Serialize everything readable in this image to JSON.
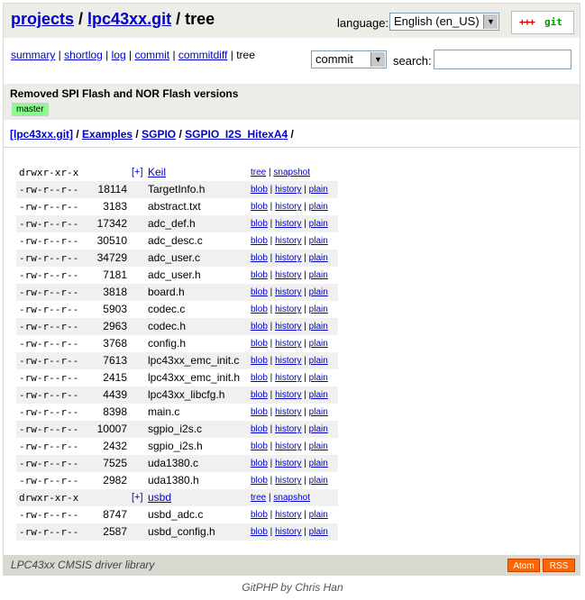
{
  "header": {
    "breadcrumb_projects": "projects",
    "breadcrumb_sep1": " / ",
    "breadcrumb_repo": "lpc43xx.git",
    "breadcrumb_sep2": " / tree",
    "language_label": "language:",
    "language_value": "English (en_US)",
    "logo_plus": "+++",
    "logo_text": "git"
  },
  "nav": {
    "links": [
      "summary",
      "shortlog",
      "log",
      "commit",
      "commitdiff"
    ],
    "current": "tree",
    "search_type": "commit",
    "search_label": "search:",
    "search_value": ""
  },
  "commit": {
    "title": "Removed SPI Flash and NOR Flash versions",
    "branch": "master"
  },
  "path": {
    "root": "[lpc43xx.git]",
    "segments": [
      "Examples",
      "SGPIO",
      "SGPIO_I2S_HitexA4"
    ],
    "sep": " / "
  },
  "tree": {
    "expand_label": "[+]",
    "dir_actions": [
      "tree",
      "snapshot"
    ],
    "file_actions": [
      "blob",
      "history",
      "plain"
    ],
    "entries": [
      {
        "mode": "drwxr-xr-x",
        "size": "",
        "name": "Keil",
        "dir": true
      },
      {
        "mode": "-rw-r--r--",
        "size": "18114",
        "name": "TargetInfo.h",
        "dir": false
      },
      {
        "mode": "-rw-r--r--",
        "size": "3183",
        "name": "abstract.txt",
        "dir": false
      },
      {
        "mode": "-rw-r--r--",
        "size": "17342",
        "name": "adc_def.h",
        "dir": false
      },
      {
        "mode": "-rw-r--r--",
        "size": "30510",
        "name": "adc_desc.c",
        "dir": false
      },
      {
        "mode": "-rw-r--r--",
        "size": "34729",
        "name": "adc_user.c",
        "dir": false
      },
      {
        "mode": "-rw-r--r--",
        "size": "7181",
        "name": "adc_user.h",
        "dir": false
      },
      {
        "mode": "-rw-r--r--",
        "size": "3818",
        "name": "board.h",
        "dir": false
      },
      {
        "mode": "-rw-r--r--",
        "size": "5903",
        "name": "codec.c",
        "dir": false
      },
      {
        "mode": "-rw-r--r--",
        "size": "2963",
        "name": "codec.h",
        "dir": false
      },
      {
        "mode": "-rw-r--r--",
        "size": "3768",
        "name": "config.h",
        "dir": false
      },
      {
        "mode": "-rw-r--r--",
        "size": "7613",
        "name": "lpc43xx_emc_init.c",
        "dir": false
      },
      {
        "mode": "-rw-r--r--",
        "size": "2415",
        "name": "lpc43xx_emc_init.h",
        "dir": false
      },
      {
        "mode": "-rw-r--r--",
        "size": "4439",
        "name": "lpc43xx_libcfg.h",
        "dir": false
      },
      {
        "mode": "-rw-r--r--",
        "size": "8398",
        "name": "main.c",
        "dir": false
      },
      {
        "mode": "-rw-r--r--",
        "size": "10007",
        "name": "sgpio_i2s.c",
        "dir": false
      },
      {
        "mode": "-rw-r--r--",
        "size": "2432",
        "name": "sgpio_i2s.h",
        "dir": false
      },
      {
        "mode": "-rw-r--r--",
        "size": "7525",
        "name": "uda1380.c",
        "dir": false
      },
      {
        "mode": "-rw-r--r--",
        "size": "2982",
        "name": "uda1380.h",
        "dir": false
      },
      {
        "mode": "drwxr-xr-x",
        "size": "",
        "name": "usbd",
        "dir": true
      },
      {
        "mode": "-rw-r--r--",
        "size": "8747",
        "name": "usbd_adc.c",
        "dir": false
      },
      {
        "mode": "-rw-r--r--",
        "size": "2587",
        "name": "usbd_config.h",
        "dir": false
      }
    ]
  },
  "footer": {
    "description": "LPC43xx CMSIS driver library",
    "atom": "Atom",
    "rss": "RSS",
    "credit": "GitPHP by Chris Han"
  },
  "colors": {
    "header_bg": "#edece6",
    "link": "#0000cc",
    "badge_bg": "#88ff88",
    "feed_bg": "#ff6600"
  }
}
